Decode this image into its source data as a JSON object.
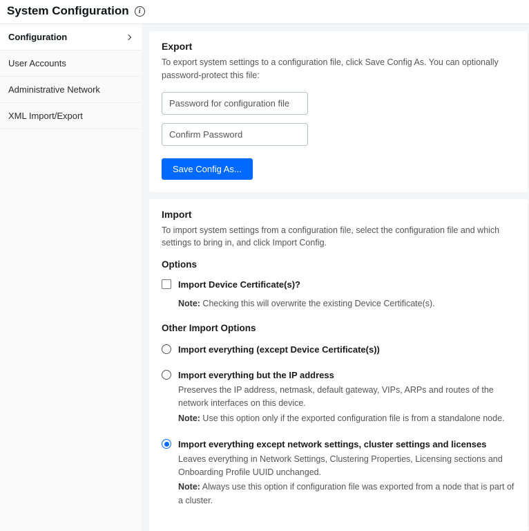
{
  "page_title": "System Configuration",
  "sidebar": {
    "items": [
      {
        "label": "Configuration",
        "active": true,
        "expandable": true
      },
      {
        "label": "User Accounts"
      },
      {
        "label": "Administrative Network"
      },
      {
        "label": "XML Import/Export"
      }
    ]
  },
  "export": {
    "title": "Export",
    "desc": "To export system settings to a configuration file, click Save Config As. You can optionally password-protect this file:",
    "password_placeholder": "Password for configuration file",
    "confirm_placeholder": "Confirm Password",
    "save_button": "Save Config As..."
  },
  "import": {
    "title": "Import",
    "desc": "To import system settings from a configuration file, select the configuration file and which settings to bring in, and click Import Config.",
    "options_title": "Options",
    "cert_checkbox_label": "Import Device Certificate(s)?",
    "cert_note_prefix": "Note:",
    "cert_note_text": " Checking this will overwrite the existing Device Certificate(s).",
    "other_title": "Other Import Options",
    "radios": [
      {
        "label": "Import everything (except Device Certificate(s))",
        "selected": false
      },
      {
        "label": "Import everything but the IP address",
        "selected": false,
        "desc": "Preserves the IP address, netmask, default gateway, VIPs, ARPs and routes of the network interfaces on this device.",
        "note_prefix": "Note:",
        "note_text": " Use this option only if the exported configuration file is from a standalone node."
      },
      {
        "label": "Import everything except network settings, cluster settings and licenses",
        "selected": true,
        "desc": "Leaves everything in Network Settings, Clustering Properties, Licensing sections and Onboarding Profile UUID unchanged.",
        "note_prefix": "Note:",
        "note_text": " Always use this option if configuration file was exported from a node that is part of a cluster."
      }
    ]
  }
}
